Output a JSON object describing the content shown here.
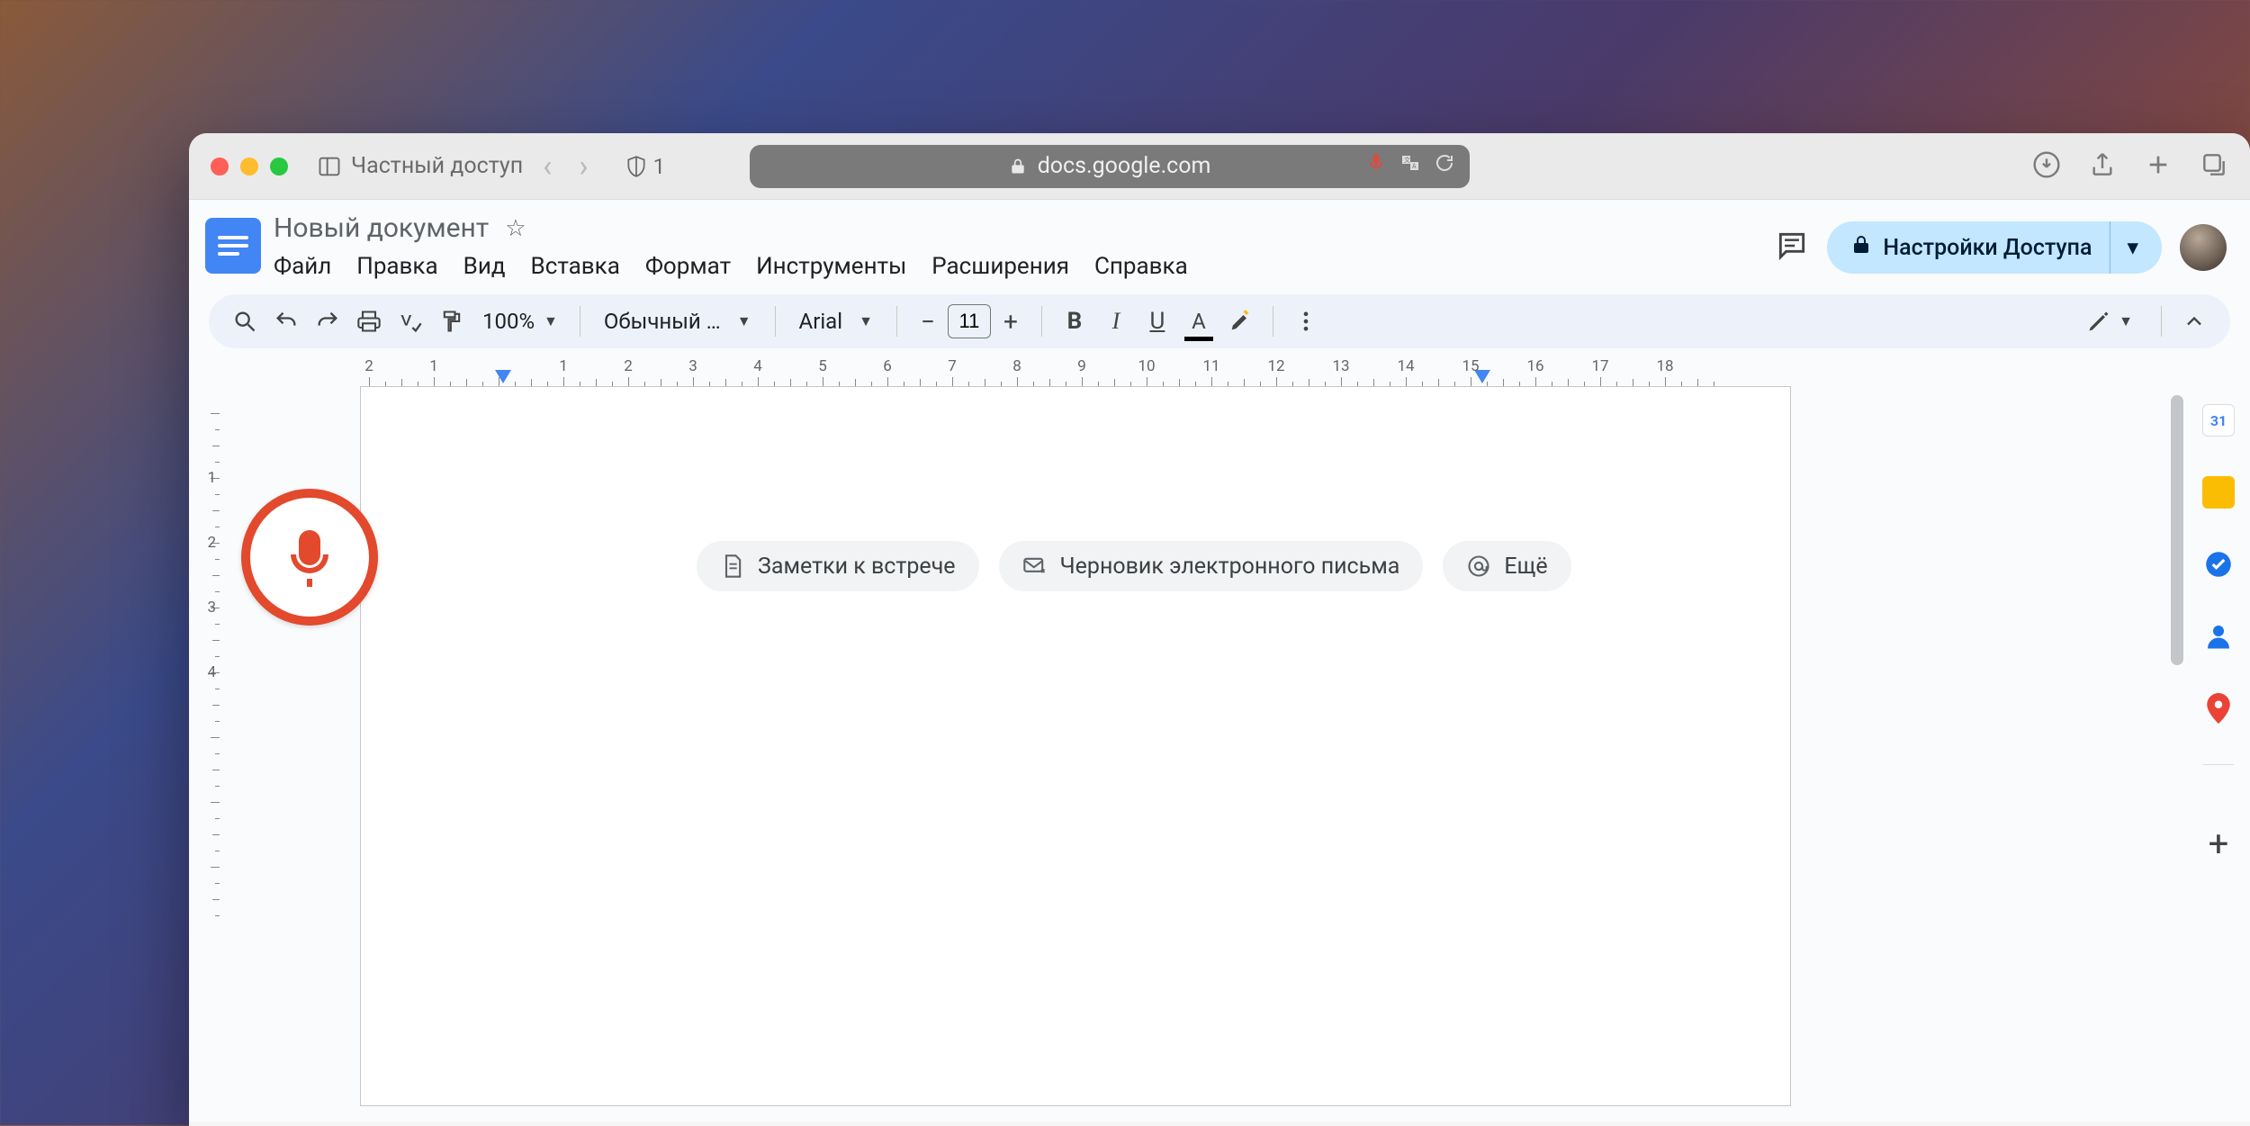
{
  "browser": {
    "private_label": "Частный доступ",
    "tabs_count": "1",
    "url_host": "docs.google.com"
  },
  "header": {
    "doc_title": "Новый документ",
    "menus": [
      "Файл",
      "Правка",
      "Вид",
      "Вставка",
      "Формат",
      "Инструменты",
      "Расширения",
      "Справка"
    ],
    "share_label": "Настройки Доступа"
  },
  "toolbar": {
    "zoom": "100%",
    "style": "Обычный …",
    "font": "Arial",
    "font_size": "11"
  },
  "ruler": {
    "h_labels": [
      "2",
      "1",
      "",
      "1",
      "2",
      "3",
      "4",
      "5",
      "6",
      "7",
      "8",
      "9",
      "10",
      "11",
      "12",
      "13",
      "14",
      "15",
      "16",
      "17",
      "18"
    ],
    "v_labels": [
      "",
      "1",
      "2",
      "3",
      "4"
    ]
  },
  "chips": {
    "meeting": "Заметки к встрече",
    "email": "Черновик электронного письма",
    "more": "Ещё"
  },
  "side_apps": {
    "calendar_day": "31"
  }
}
